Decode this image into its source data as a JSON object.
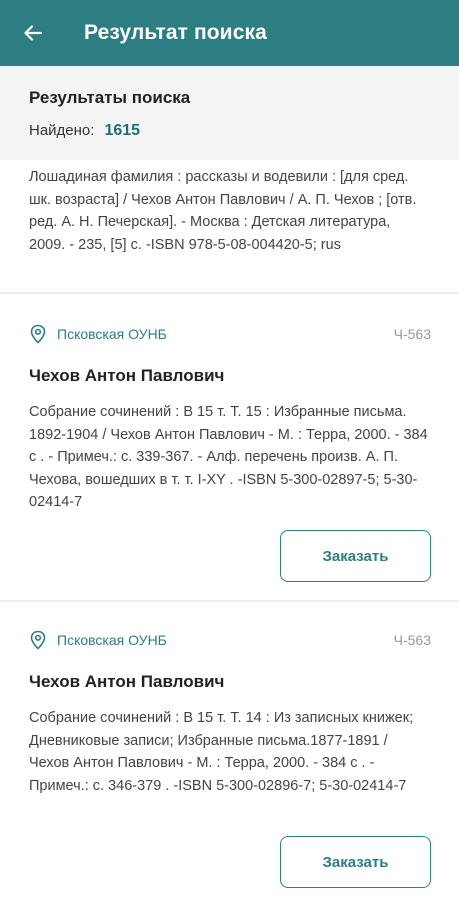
{
  "appbar": {
    "title": "Результат поиска"
  },
  "summary": {
    "title": "Результаты поиска",
    "found_label": "Найдено:",
    "found_count": "1615"
  },
  "results": [
    {
      "description": "Лошадиная фамилия : рассказы и водевили : [для сред. шк. возраста] / Чехов Антон Павлович / А. П. Чехов ; [отв. ред. А. Н. Печерская]. - Москва : Детская литература, 2009. - 235, [5] с. -ISBN 978-5-08-004420-5; rus"
    },
    {
      "library": "Псковская ОУНБ",
      "code": "Ч-563",
      "author": "Чехов Антон Павлович",
      "description": "Собрание сочинений : В 15 т. Т. 15 : Избранные письма. 1892-1904 / Чехов Антон Павлович - М. : Терра, 2000. - 384 с . - Примеч.: с. 339-367. - Алф. перечень произв. А. П. Чехова, вошедших в т. т. I-XY . -ISBN 5-300-02897-5; 5-30-02414-7",
      "button": "Заказать"
    },
    {
      "library": "Псковская ОУНБ",
      "code": "Ч-563",
      "author": "Чехов Антон Павлович",
      "description": "Собрание сочинений : В 15 т. Т. 14 : Из записных книжек; Дневниковые записи; Избранные письма.1877-1891 / Чехов Антон Павлович - М. : Терра, 2000. - 384 с . - Примеч.: с. 346-379 . -ISBN 5-300-02896-7; 5-30-02414-7",
      "button": "Заказать"
    }
  ],
  "icons": {
    "back": "arrow-left-icon",
    "location": "location-pin-icon"
  },
  "colors": {
    "primary": "#2d7e83",
    "count": "#1f6f74",
    "summary_bg": "#f4f4f4"
  }
}
